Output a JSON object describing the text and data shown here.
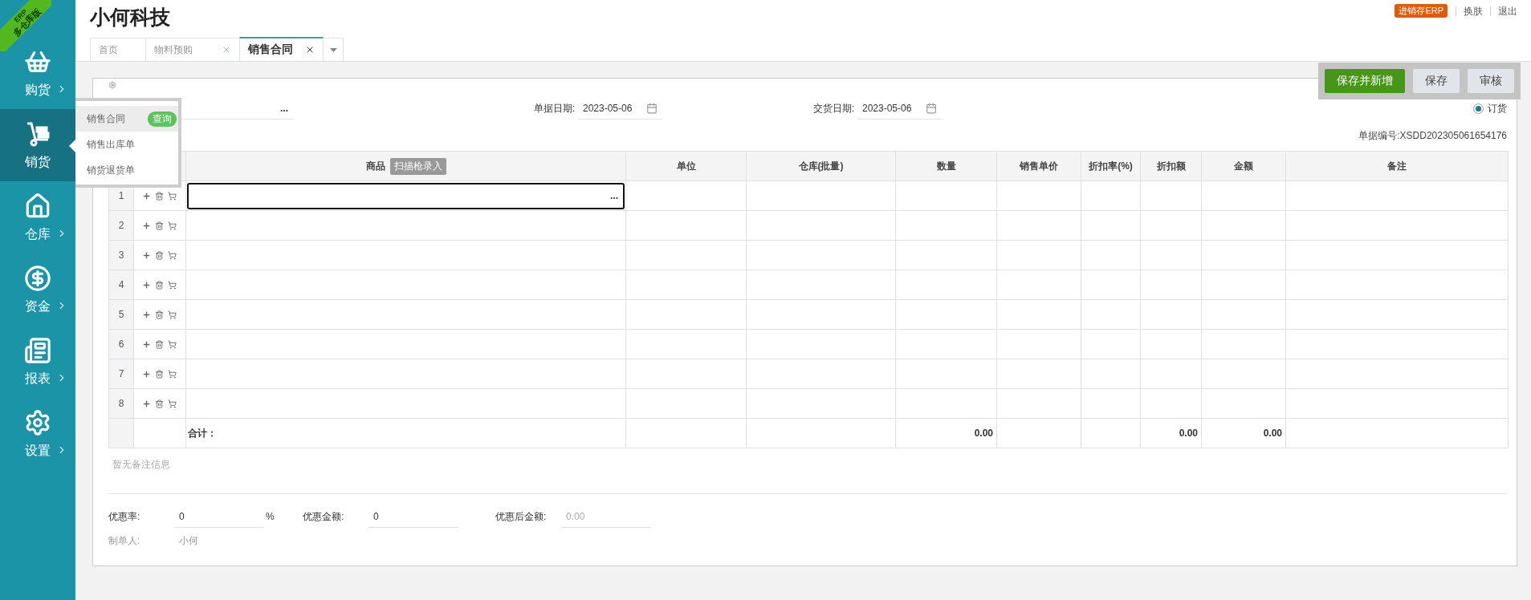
{
  "brand_ribbon": {
    "top": "ERP",
    "bottom": "多仓库版"
  },
  "sidebar": {
    "items": [
      {
        "label": "购货",
        "kind": "basket",
        "selected": false,
        "expanded": false
      },
      {
        "label": "销货",
        "kind": "dolly",
        "selected": true,
        "expanded": true
      },
      {
        "label": "仓库",
        "kind": "house",
        "selected": false,
        "expanded": false
      },
      {
        "label": "资金",
        "kind": "dollar",
        "selected": false,
        "expanded": false
      },
      {
        "label": "报表",
        "kind": "report",
        "selected": false,
        "expanded": false
      },
      {
        "label": "设置",
        "kind": "gear",
        "selected": false,
        "expanded": false
      }
    ]
  },
  "flyout_menu": {
    "items": [
      {
        "label": "销售合同",
        "selected": true,
        "badge": "查询"
      },
      {
        "label": "销售出库单",
        "selected": false
      },
      {
        "label": "销货退货单",
        "selected": false
      }
    ]
  },
  "header": {
    "title": "小何科技",
    "badge": "进销存ERP",
    "links": [
      "换肤",
      "退出"
    ]
  },
  "tabs": [
    {
      "label": "首页",
      "selected": false,
      "closable": false
    },
    {
      "label": "物料预购",
      "selected": false,
      "closable": true
    },
    {
      "label": "销售合同",
      "selected": true,
      "closable": true
    }
  ],
  "toolbar": {
    "buttons": [
      {
        "label": "保存并新增",
        "kind": "primary"
      },
      {
        "label": "保存",
        "kind": "default"
      },
      {
        "label": "审核",
        "kind": "default"
      }
    ]
  },
  "form": {
    "customer_picker": "...",
    "dates": [
      {
        "label": "单据日期:",
        "value": "2023-05-06"
      },
      {
        "label": "交货日期:",
        "value": "2023-05-06"
      }
    ],
    "order_type": {
      "label": "订货",
      "selected": true
    },
    "doc_number": "单据编号:XSDD202305061654176"
  },
  "table": {
    "columns": [
      {
        "label": "商品",
        "badge": "扫描枪录入"
      },
      {
        "label": "单位"
      },
      {
        "label": "仓库(批量)"
      },
      {
        "label": "数量",
        "total": "0.00"
      },
      {
        "label": "销售单价"
      },
      {
        "label": "折扣率(%)"
      },
      {
        "label": "折扣额",
        "total": "0.00"
      },
      {
        "label": "金额",
        "total": "0.00"
      },
      {
        "label": "备注"
      }
    ],
    "rows": [
      {
        "number": "1",
        "editing": true,
        "picker": "..."
      },
      {
        "number": "2",
        "editing": false
      },
      {
        "number": "3",
        "editing": false
      },
      {
        "number": "4",
        "editing": false
      },
      {
        "number": "5",
        "editing": false
      },
      {
        "number": "6",
        "editing": false
      },
      {
        "number": "7",
        "editing": false
      },
      {
        "number": "8",
        "editing": false
      }
    ],
    "total_label": "合计："
  },
  "remarks": {
    "placeholder": "暂无备注信息"
  },
  "summary": [
    {
      "label": "优惠率:",
      "value": "0",
      "unit": "%",
      "disabled": false
    },
    {
      "label": "优惠金额:",
      "value": "0",
      "disabled": false
    },
    {
      "label": "优惠后金额:",
      "value": "0.00",
      "disabled": true
    }
  ],
  "creator": {
    "label": "制单人:",
    "value": "小何"
  }
}
